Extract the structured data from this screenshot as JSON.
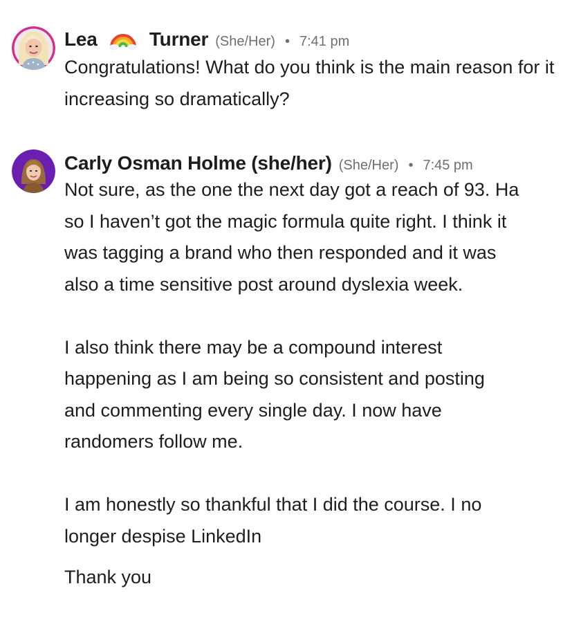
{
  "comments": [
    {
      "author_first": "Lea",
      "author_emoji": "rainbow-icon",
      "author_last": "Turner",
      "pronouns": "(She/Her)",
      "separator": "•",
      "time": "7:41 pm",
      "paragraphs": [
        "Congratulations! What do you think is the main reason for it increasing so dramatically?"
      ]
    },
    {
      "author": "Carly Osman Holme (she/her)",
      "pronouns": "(She/Her)",
      "separator": "•",
      "time": "7:45 pm",
      "paragraphs": [
        "Not sure, as the one the next day got a reach of 93. Ha so I haven’t got the magic formula quite right. I think it was tagging a brand who then responded and  it was also a time sensitive post around dyslexia week.",
        "I also think there may be a compound interest happening as I am being so consistent and posting and commenting every single day. I now have randomers follow me.",
        "I am honestly so thankful that I did the course. I no longer despise LinkedIn",
        "Thank you"
      ]
    }
  ],
  "colors": {
    "text": "#1d1d1f",
    "meta": "#6e6e73",
    "avatar1_ring": "#d12f8f",
    "avatar2_bg": "#6a1fb0"
  }
}
